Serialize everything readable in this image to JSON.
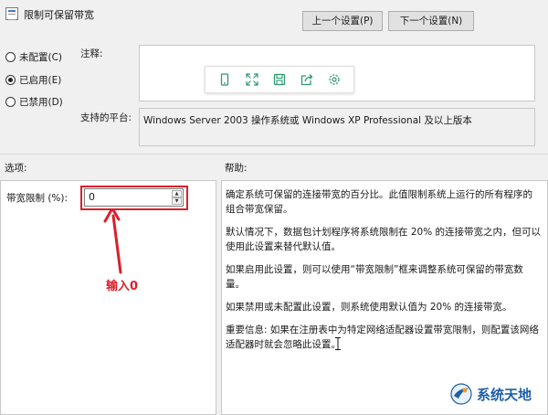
{
  "window": {
    "title": "限制可保留带宽"
  },
  "nav": {
    "prev_label": "上一个设置(P)",
    "next_label": "下一个设置(N)"
  },
  "state": {
    "options": [
      {
        "label": "未配置(C)",
        "checked": false
      },
      {
        "label": "已启用(E)",
        "checked": true
      },
      {
        "label": "已禁用(D)",
        "checked": false
      }
    ]
  },
  "comment": {
    "label": "注释:",
    "value": ""
  },
  "platform": {
    "label": "支持的平台:",
    "value": "Windows Server 2003 操作系统或 Windows XP Professional 及以上版本"
  },
  "toolbar": {
    "icons": [
      "phone-icon",
      "fullscreen-icon",
      "save-icon",
      "share-icon",
      "settings-icon"
    ]
  },
  "options_section": {
    "label": "选项:"
  },
  "help_section": {
    "label": "帮助:"
  },
  "bandwidth": {
    "label": "带宽限制 (%):",
    "value": "0"
  },
  "annotation": {
    "text": "输入0",
    "color": "#d9202a"
  },
  "help": {
    "paragraphs": [
      "确定系统可保留的连接带宽的百分比。此值限制系统上运行的所有程序的组合带宽保留。",
      "默认情况下，数据包计划程序将系统限制在 20% 的连接带宽之内，但可以使用此设置来替代默认值。",
      "如果启用此设置，则可以使用“带宽限制”框来调整系统可保留的带宽数量。",
      "如果禁用或未配置此设置，则系统使用默认值为 20% 的连接带宽。",
      "重要信息: 如果在注册表中为特定网络适配器设置带宽限制，则配置该网络适配器时就会忽略此设置。"
    ]
  },
  "watermark": {
    "text": "系统天地",
    "color": "#1d5fa8"
  }
}
